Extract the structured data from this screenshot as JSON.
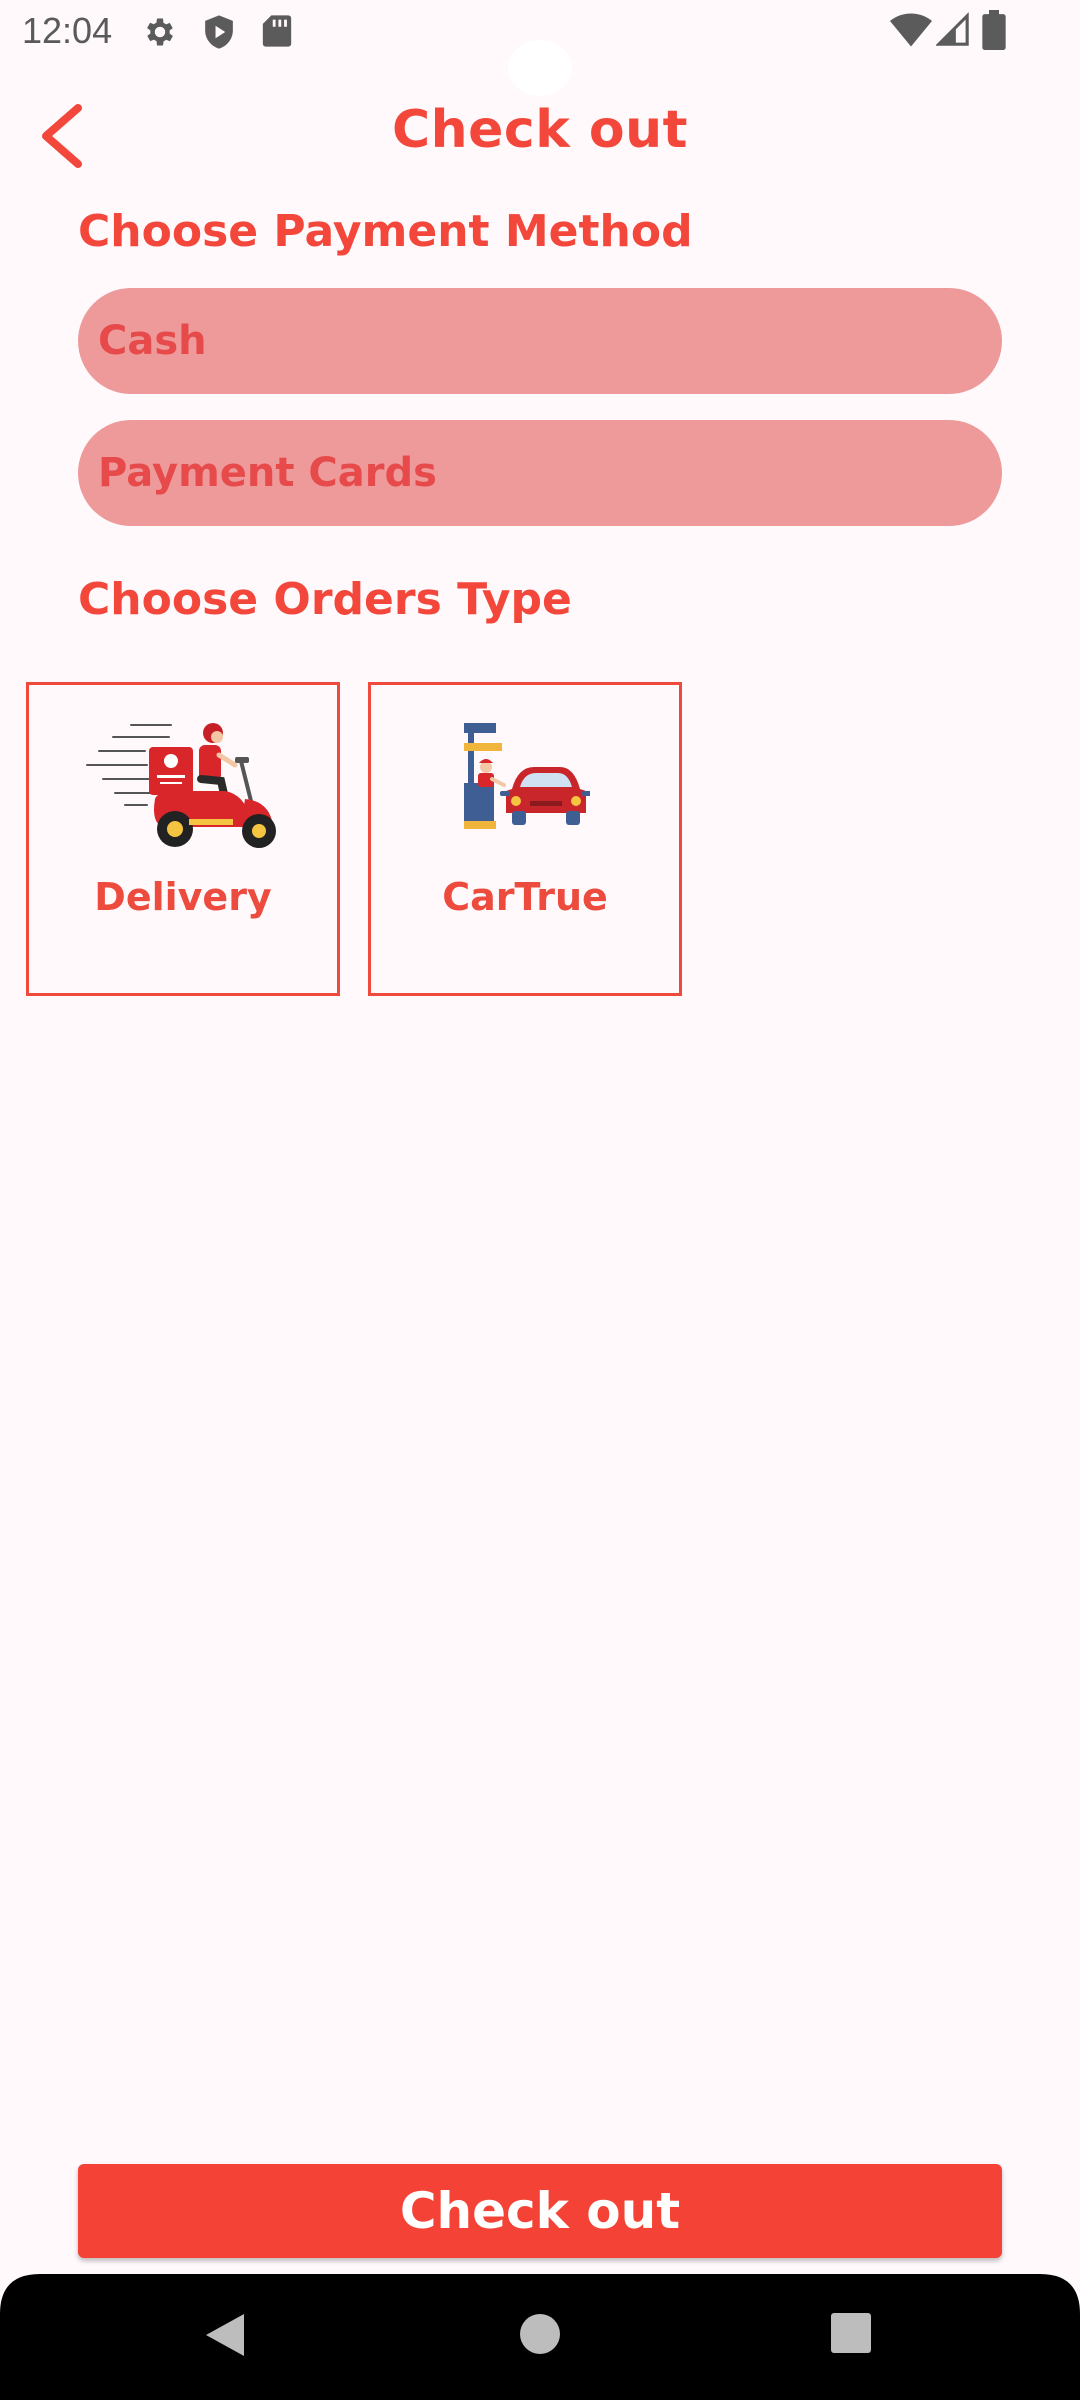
{
  "status_bar": {
    "time": "12:04",
    "left_icons": [
      "gear-icon",
      "shield-play-icon",
      "sd-card-icon"
    ],
    "right_icons": [
      "wifi-icon",
      "cell-signal-icon",
      "battery-icon"
    ]
  },
  "header": {
    "title": "Check out",
    "back_icon": "chevron-left-icon"
  },
  "payment": {
    "section_title": "Choose Payment Method",
    "options": [
      {
        "label": "Cash"
      },
      {
        "label": "Payment Cards"
      }
    ]
  },
  "orders": {
    "section_title": "Choose Orders Type",
    "types": [
      {
        "label": "Delivery",
        "icon": "scooter-delivery-icon"
      },
      {
        "label": "CarTrue",
        "icon": "drive-thru-icon"
      }
    ]
  },
  "checkout_button": {
    "label": "Check out"
  },
  "nav_bar": {
    "icons": [
      "back-triangle-icon",
      "home-circle-icon",
      "recents-square-icon"
    ]
  },
  "colors": {
    "accent": "#f44336",
    "title_red": "#f2473a",
    "option_fill": "#ee9a9b",
    "option_text": "#e74a4a",
    "background": "#fff9fc"
  }
}
